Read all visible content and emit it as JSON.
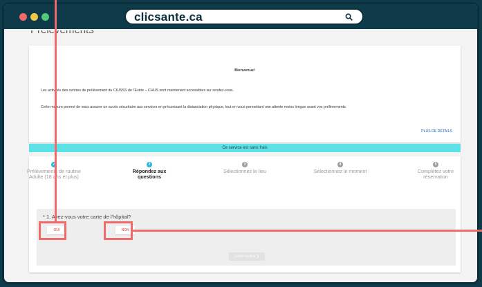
{
  "browser": {
    "url": "clicsante.ca",
    "search_icon": "search-icon",
    "dots": [
      "#f06a6a",
      "#f0c94a",
      "#4ec97a"
    ]
  },
  "page": {
    "heading": "Prélèvements",
    "welcome_title": "Bienvenue!",
    "welcome_p1": "Les activités des centres de prélèvement du CIUSSS de l'Estrie – CHUS sont maintenant accessibles sur rendez-vous.",
    "welcome_p2": "Cette mesure permet de vous assurer un accès sécuritaire aux services en préconisant la distanciation physique, tout en vous permettant une attente moins longue avant vos prélèvements.",
    "more_link": "PLUS DE DÉTAILS",
    "free_banner": "Ce service est sans frais"
  },
  "steps": [
    {
      "num": "✓",
      "label": "Prélèvements de routine Adulte (18 ans et plus)",
      "state": "done"
    },
    {
      "num": "2",
      "label": "Répondez aux questions",
      "state": "active"
    },
    {
      "num": "3",
      "label": "Sélectionnez le lieu",
      "state": "todo"
    },
    {
      "num": "4",
      "label": "Sélectionnez le moment",
      "state": "todo"
    },
    {
      "num": "5",
      "label": "Complétez votre réservation",
      "state": "todo"
    }
  ],
  "question": {
    "text": "* 1. Avez-vous votre carte de l'hôpital?",
    "yes": "OUI",
    "no": "NON",
    "continue": "CONTINUER ❯"
  },
  "colors": {
    "frame": "#0f3a4a",
    "accent": "#2bb8e0",
    "banner": "#5ce1e6",
    "highlight": "#f06a6a",
    "link": "#1565c0"
  }
}
